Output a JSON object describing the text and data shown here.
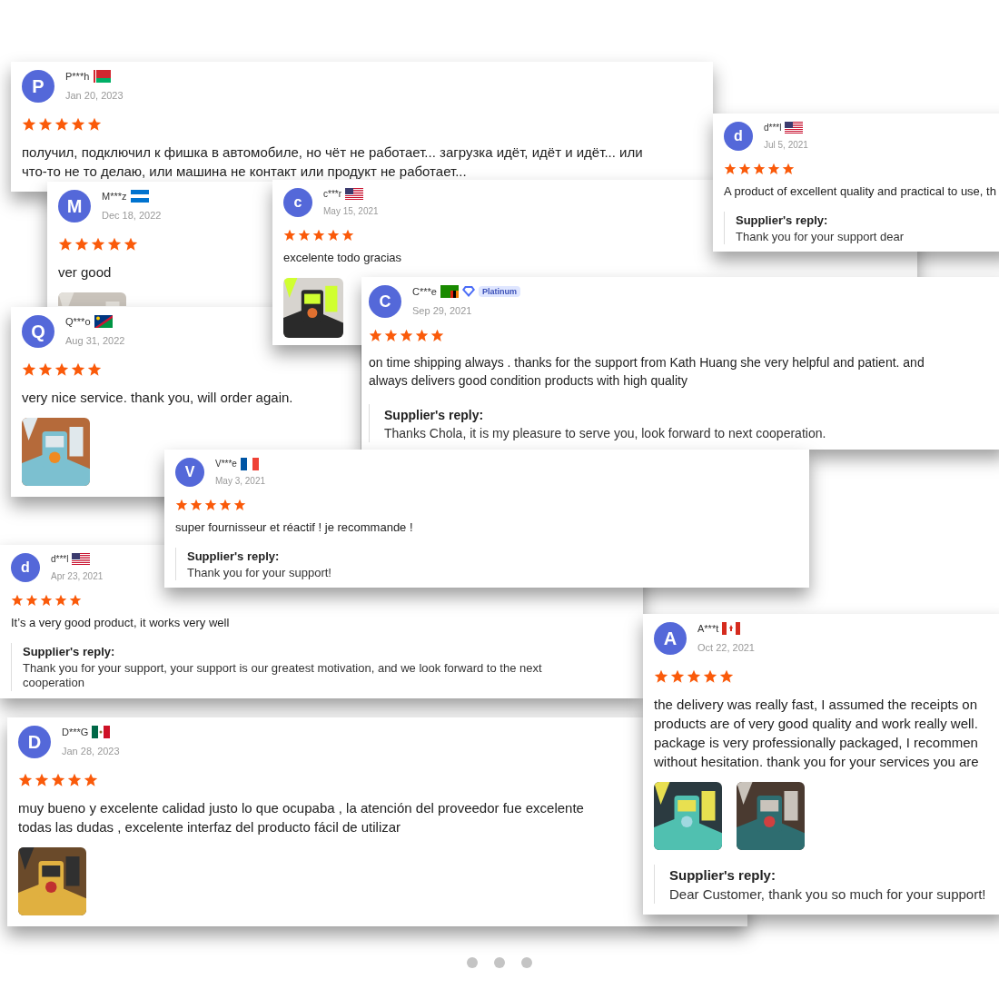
{
  "reviews": [
    {
      "initial": "P",
      "name": "P***h",
      "date": "Jan 20, 2023",
      "stars": 5,
      "lines": [
        "получил, подключил к фишка в автомобиле, но чёт не работает... загрузка идёт, идёт и идёт... или",
        "что-то не то делаю, или машина не контакт или продукт не работает..."
      ]
    },
    {
      "initial": "d",
      "name": "d***l",
      "date": "Jul 5, 2021",
      "stars": 5,
      "lines": [
        "A product of excellent quality and practical to use, th"
      ],
      "reply": {
        "label": "Supplier's reply:",
        "lines": [
          "Thank you for your support dear"
        ]
      }
    },
    {
      "initial": "M",
      "name": "M***z",
      "date": "Dec 18, 2022",
      "stars": 5,
      "lines": [
        "ver good"
      ],
      "photos": [
        {
          "kind": "picture"
        }
      ]
    },
    {
      "initial": "c",
      "name": "c***r",
      "date": "May 15, 2021",
      "stars": 5,
      "lines": [
        "excelente todo gracias"
      ],
      "photos": [
        {
          "kind": "picture"
        }
      ]
    },
    {
      "initial": "Q",
      "name": "Q***o",
      "date": "Aug 31, 2022",
      "stars": 5,
      "lines": [
        "very nice service. thank you, will order again."
      ],
      "photos": [
        {
          "kind": "picture"
        }
      ]
    },
    {
      "initial": "C",
      "name": "C***e",
      "badge": "Platinum",
      "date": "Sep 29, 2021",
      "stars": 5,
      "lines": [
        "on time shipping always . thanks for the support from Kath Huang she very helpful and patient. and",
        "always delivers good condition products with high quality"
      ],
      "reply": {
        "label": "Supplier's reply:",
        "lines": [
          "Thanks Chola, it is my pleasure to serve you, look forward to next cooperation."
        ]
      }
    },
    {
      "initial": "V",
      "name": "V***e",
      "date": "May 3, 2021",
      "stars": 5,
      "lines": [
        "super fournisseur et réactif ! je recommande !"
      ],
      "reply": {
        "label": "Supplier's reply:",
        "lines": [
          "Thank you for your support!"
        ]
      }
    },
    {
      "initial": "d",
      "name": "d***l",
      "date": "Apr 23, 2021",
      "stars": 5,
      "lines": [
        "It’s a very good product, it works very well"
      ],
      "reply": {
        "label": "Supplier's reply:",
        "lines": [
          "Thank you for your support, your support is our greatest motivation, and we look forward to the next",
          "cooperation"
        ]
      }
    },
    {
      "initial": "A",
      "name": "A***t",
      "date": "Oct 22, 2021",
      "stars": 5,
      "lines": [
        "the delivery was really fast, I assumed the receipts on",
        "products are of very good quality and work really well.",
        "package is very professionally packaged, I recommen",
        "without hesitation. thank you for your services you are"
      ],
      "photos": [
        {
          "kind": "picture"
        },
        {
          "kind": "picture"
        }
      ],
      "reply": {
        "label": "Supplier's reply:",
        "lines": [
          "Dear Customer, thank you so much for your support!"
        ]
      }
    },
    {
      "initial": "D",
      "name": "D***G",
      "date": "Jan 28, 2023",
      "stars": 5,
      "lines": [
        "muy bueno y excelente calidad justo lo que ocupaba , la atención del proveedor fue excelente",
        "todas las dudas , excelente interfaz del producto fácil de utilizar"
      ],
      "photos": [
        {
          "kind": "picture"
        }
      ]
    }
  ],
  "pager_dots": [
    {
      "selected": false
    },
    {
      "selected": false
    },
    {
      "selected": false
    }
  ]
}
